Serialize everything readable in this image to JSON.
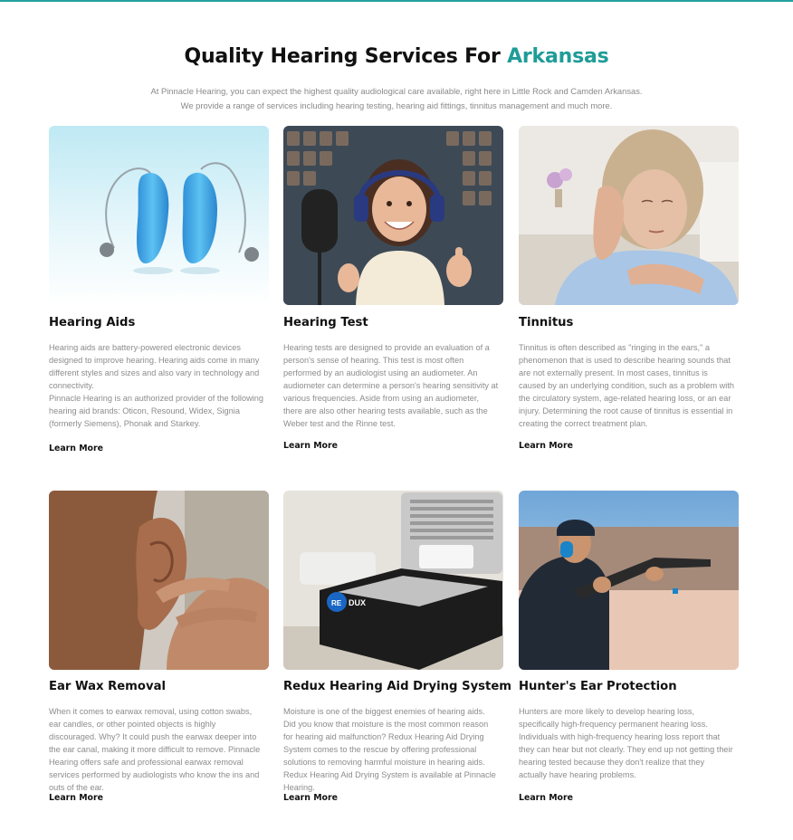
{
  "header": {
    "title_prefix": "Quality Hearing Services For ",
    "title_accent": "Arkansas",
    "intro_line1": "At Pinnacle Hearing, you can expect the highest quality audiological care available, right here in Little Rock and Camden Arkansas.",
    "intro_line2": "We provide a range of services including hearing testing, hearing aid fittings, tinnitus management and much more."
  },
  "colors": {
    "accent": "#1f9c98",
    "text": "#111111",
    "muted": "#8c8c8c"
  },
  "services": [
    {
      "title": "Hearing Aids",
      "image_alt": "Two blue behind-the-ear hearing aids",
      "desc_p1": "Hearing aids are battery-powered electronic devices designed to improve hearing. Hearing aids come in many different styles and sizes and also vary in technology and connectivity.",
      "desc_p2": "Pinnacle Hearing is an authorized provider of the following hearing aid brands: Oticon, Resound, Widex, Signia (formerly Siemens), Phonak and Starkey.",
      "link": "Learn More"
    },
    {
      "title": "Hearing Test",
      "image_alt": "Smiling girl with headphones giving thumbs up",
      "desc_p1": "Hearing tests are designed to provide an evaluation of a person's sense of hearing. This test is most often performed by an audiologist using an audiometer. An audiometer can determine a person's hearing sensitivity at various frequencies. Aside from using an audiometer, there are also other hearing tests available, such as the Weber test and the Rinne test.",
      "link": "Learn More"
    },
    {
      "title": "Tinnitus",
      "image_alt": "Woman holding her ear in discomfort",
      "desc_p1": "Tinnitus is often described as \"ringing in the ears,\" a phenomenon that is used to describe hearing sounds that are not externally present. In most cases, tinnitus is caused by an underlying condition, such as a problem with the circulatory system, age-related hearing loss, or an ear injury. Determining the root cause of tinnitus is essential in creating the correct treatment plan.",
      "link": "Learn More"
    },
    {
      "title": "Ear Wax Removal",
      "image_alt": "Close-up of a finger in an ear",
      "desc_p1": "When it comes to earwax removal, using cotton swabs, ear candles, or other pointed objects is highly discouraged. Why? It could push the earwax deeper into the ear canal, making it more difficult to remove.  Pinnacle Hearing offers safe and professional earwax removal services performed by audiologists who know the ins and outs of the ear.",
      "link": "Learn More"
    },
    {
      "title": "Redux Hearing Aid Drying System",
      "image_alt": "Redux hearing aid drying device",
      "logo_text": "REDUX",
      "desc_p1": "Moisture is one of the biggest enemies of hearing aids. Did you know that moisture is the most common reason for hearing aid malfunction? Redux Hearing Aid Drying System comes to the rescue by offering professional solutions to removing harmful moisture in hearing aids. Redux Hearing Aid Drying System is available at Pinnacle Hearing.",
      "link": "Learn More"
    },
    {
      "title": "Hunter's Ear Protection",
      "image_alt": "Man with ear protection shooting a shotgun",
      "desc_p1": "Hunters are more likely to develop hearing loss, specifically high-frequency permanent hearing loss. Individuals with high-frequency hearing loss report that they can hear but not clearly. They end up not getting their hearing tested because they don't realize that they actually have hearing problems.",
      "link": "Learn More"
    }
  ]
}
